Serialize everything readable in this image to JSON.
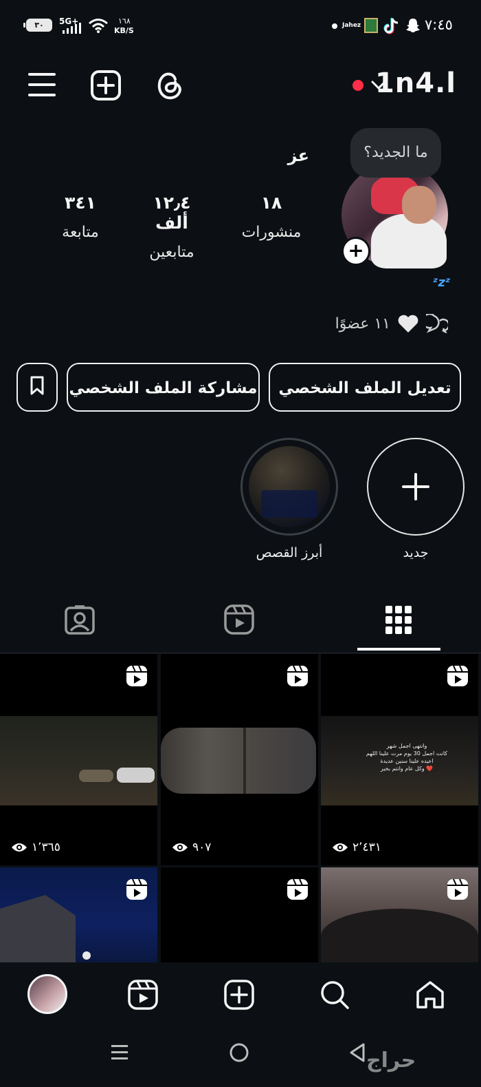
{
  "status_bar": {
    "time": "٧:٤٥",
    "battery": "٣٠",
    "network": "5G+",
    "data_speed_value": "١٦٨",
    "data_speed_unit": "KB/S",
    "notif_app": "Jahez"
  },
  "header": {
    "username": "1n4.l"
  },
  "profile": {
    "note_bubble": "ما الجديد؟",
    "name": "عز",
    "stats": [
      {
        "value": "١٨",
        "label": "منشورات"
      },
      {
        "value": "١٢٫٤ ألف",
        "label": "متابعين"
      },
      {
        "value": "٣٤١",
        "label": "متابعة"
      }
    ],
    "members_text": "١١ عضوًا"
  },
  "actions": {
    "edit_profile": "تعديل الملف الشخصي",
    "share_profile": "مشاركة الملف الشخصي"
  },
  "highlights": [
    {
      "label": "جديد"
    },
    {
      "label": "أبرز القصص"
    }
  ],
  "grid": {
    "posts": [
      {
        "views": "٢٬٤٣١",
        "caption_lines": [
          "وانتهى اجمل شهر",
          "كانت اجمل 30 يوم مرت علينا اللهم",
          "اعيده علينا سنين عديدة",
          "وكل عام وانتم بخير ❤️"
        ]
      },
      {
        "views": "٩٠٧"
      },
      {
        "views": "١٬٣٦٥"
      },
      {
        "views": ""
      },
      {
        "views": ""
      },
      {
        "views": ""
      }
    ]
  },
  "watermark": "حراج",
  "colors": {
    "background": "#0c1014",
    "accent_red": "#ff2d47",
    "text": "#f5f5f5",
    "zzz_blue": "#4aa3ff"
  }
}
